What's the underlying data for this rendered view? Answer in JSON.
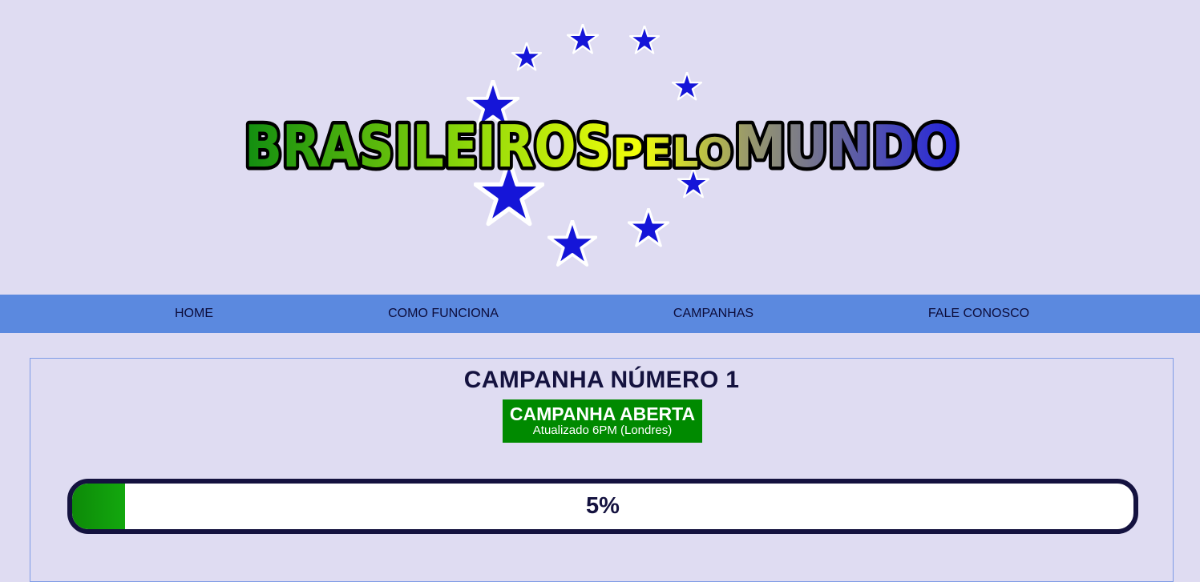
{
  "header": {
    "logo": {
      "word1": "BRASILEIROS",
      "word2": "PELO",
      "word3": "MUNDO",
      "star_color": "#1515d8",
      "gradient_colors": [
        "#109010",
        "#8fd80a",
        "#f2ff0a",
        "#2a2ad8"
      ]
    }
  },
  "nav": {
    "background": "#5b89df",
    "items": [
      {
        "label": "HOME"
      },
      {
        "label": "COMO FUNCIONA"
      },
      {
        "label": "CAMPANHAS"
      },
      {
        "label": "FALE CONOSCO"
      }
    ]
  },
  "campaign": {
    "title": "CAMPANHA NÚMERO 1",
    "status": {
      "label": "CAMPANHA ABERTA",
      "updated": "Atualizado 6PM (Londres)",
      "color": "#008a00"
    },
    "progress": {
      "percent": 5,
      "label": "5%",
      "fill_color": "#13a80e"
    }
  }
}
